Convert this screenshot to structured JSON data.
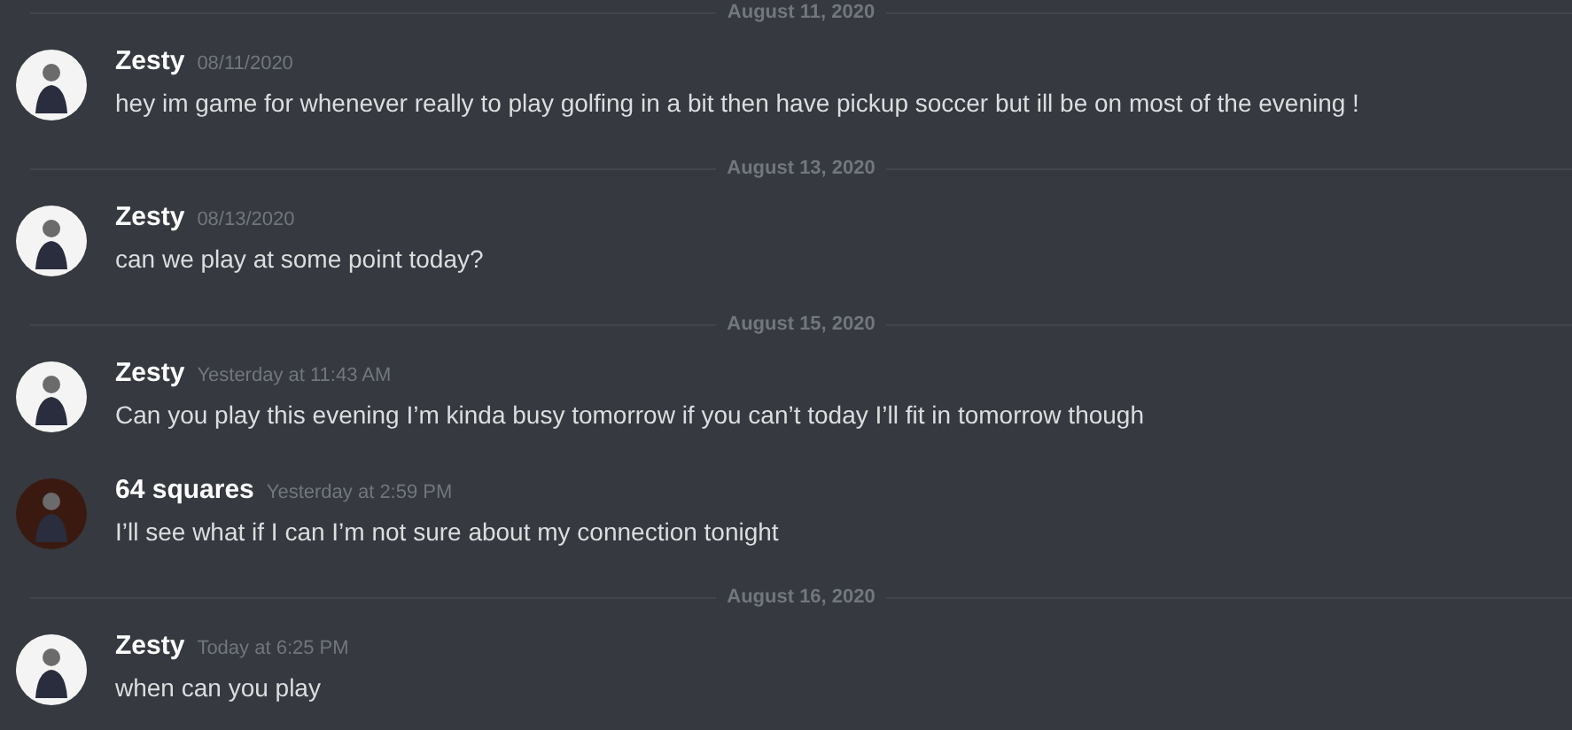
{
  "messages": [
    {
      "kind": "divider",
      "label": "August 11, 2020"
    },
    {
      "kind": "message",
      "author": "Zesty",
      "color": "#f4f4f4",
      "time": "08/11/2020",
      "text": "hey im game for whenever really to play golfing in a bit then have pickup soccer but ill be on most of the evening !"
    },
    {
      "kind": "divider",
      "label": "August 13, 2020"
    },
    {
      "kind": "message",
      "author": "Zesty",
      "color": "#f4f4f4",
      "time": "08/13/2020",
      "text": "can we play at some point today?"
    },
    {
      "kind": "divider",
      "label": "August 15, 2020"
    },
    {
      "kind": "message",
      "author": "Zesty",
      "color": "#f4f4f4",
      "time": "Yesterday at 11:43 AM",
      "text": "Can you play this evening I’m kinda busy tomorrow if you can’t today I’ll fit in tomorrow though"
    },
    {
      "kind": "message",
      "author": "64 squares",
      "color": "#3a1a10",
      "time": "Yesterday at 2:59 PM",
      "text": "I’ll see what if I can I’m not sure about my connection tonight"
    },
    {
      "kind": "divider",
      "label": "August 16, 2020"
    },
    {
      "kind": "message",
      "author": "Zesty",
      "color": "#f4f4f4",
      "time": "Today at 6:25 PM",
      "text": "when can you play"
    }
  ]
}
